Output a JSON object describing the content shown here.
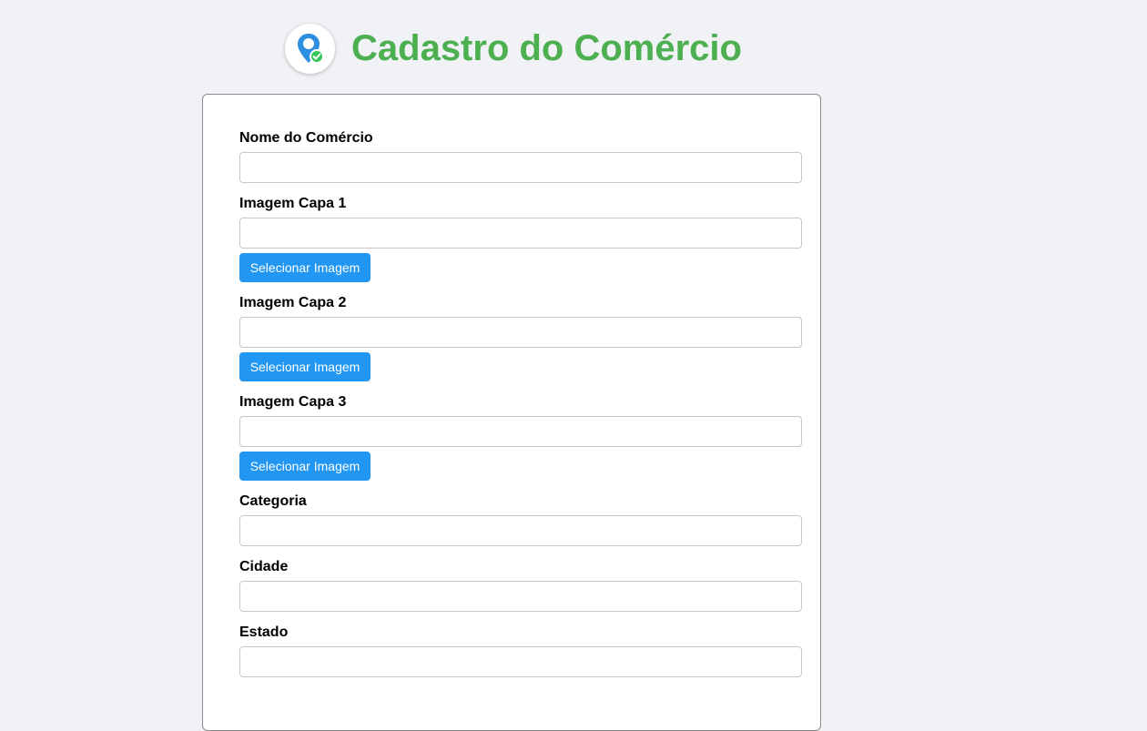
{
  "header": {
    "title": "Cadastro do Comércio",
    "logo_icon": "map-pin-check-icon"
  },
  "colors": {
    "title": "#4caf50",
    "button": "#2196f3",
    "background": "#f0f2f5",
    "pin": "#2f8fe0",
    "check": "#34c759"
  },
  "form": {
    "nome_label": "Nome do Comércio",
    "nome_value": "",
    "capa1_label": "Imagem Capa 1",
    "capa1_value": "",
    "capa1_button": "Selecionar Imagem",
    "capa2_label": "Imagem Capa 2",
    "capa2_value": "",
    "capa2_button": "Selecionar Imagem",
    "capa3_label": "Imagem Capa 3",
    "capa3_value": "",
    "capa3_button": "Selecionar Imagem",
    "categoria_label": "Categoria",
    "categoria_value": "",
    "cidade_label": "Cidade",
    "cidade_value": "",
    "estado_label": "Estado",
    "estado_value": ""
  }
}
